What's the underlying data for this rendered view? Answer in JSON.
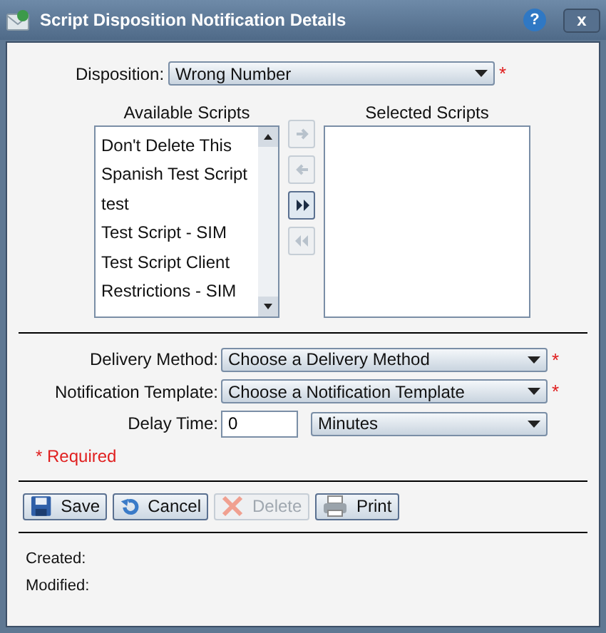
{
  "window": {
    "title": "Script Disposition Notification Details",
    "help": "?",
    "close": "x"
  },
  "disposition": {
    "label": "Disposition:",
    "value": "Wrong Number",
    "required_mark": "*"
  },
  "available_scripts": {
    "heading": "Available Scripts",
    "items": [
      {
        "label": "Don't Delete This",
        "selected": false
      },
      {
        "label": "Spanish Test Script",
        "selected": false
      },
      {
        "label": "test",
        "selected": false
      },
      {
        "label": "Test Script - SIM",
        "selected": false
      },
      {
        "label": "Test Script Client",
        "selected": false
      },
      {
        "label": "Restrictions - SIM",
        "selected": false
      }
    ]
  },
  "transfer_buttons": [
    {
      "kind": "add",
      "disabled": true
    },
    {
      "kind": "remove",
      "disabled": true
    },
    {
      "kind": "add_all",
      "disabled": false
    },
    {
      "kind": "remove_all",
      "disabled": true
    }
  ],
  "selected_scripts": {
    "heading": "Selected Scripts"
  },
  "fields": [
    {
      "kind": "select",
      "label": "Delivery Method:",
      "value": "Choose a Delivery Method",
      "required_mark": "*"
    },
    {
      "kind": "select",
      "label": "Notification Template:",
      "value": "Choose a Notification Template",
      "required_mark": "*"
    },
    {
      "kind": "delay",
      "label": "Delay Time:",
      "value": "0",
      "unit": "Minutes"
    }
  ],
  "required_note": "* Required",
  "buttons": [
    {
      "kind": "save",
      "label": "Save",
      "disabled": false
    },
    {
      "kind": "cancel",
      "label": "Cancel",
      "disabled": false
    },
    {
      "kind": "delete",
      "label": "Delete",
      "disabled": true
    },
    {
      "kind": "print",
      "label": "Print",
      "disabled": false
    }
  ],
  "footer": [
    "Created:",
    "Modified:"
  ]
}
